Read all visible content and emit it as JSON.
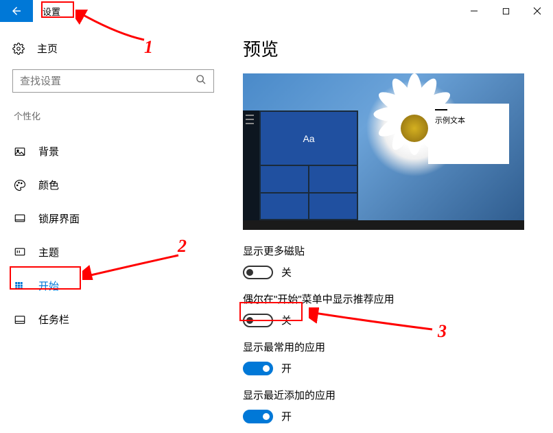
{
  "titlebar": {
    "app_title": "设置"
  },
  "sidebar": {
    "home": "主页",
    "search_placeholder": "查找设置",
    "category": "个性化",
    "items": [
      {
        "label": "背景"
      },
      {
        "label": "颜色"
      },
      {
        "label": "锁屏界面"
      },
      {
        "label": "主题"
      },
      {
        "label": "开始"
      },
      {
        "label": "任务栏"
      }
    ]
  },
  "main": {
    "heading": "预览",
    "preview": {
      "tile_text": "Aa",
      "sample_text": "示例文本"
    },
    "settings": [
      {
        "label": "显示更多磁贴",
        "state": "关",
        "on": false
      },
      {
        "label": "偶尔在\"开始\"菜单中显示推荐应用",
        "state": "关",
        "on": false
      },
      {
        "label": "显示最常用的应用",
        "state": "开",
        "on": true
      },
      {
        "label": "显示最近添加的应用",
        "state": "开",
        "on": true
      }
    ]
  },
  "annotations": {
    "n1": "1",
    "n2": "2",
    "n3": "3"
  }
}
